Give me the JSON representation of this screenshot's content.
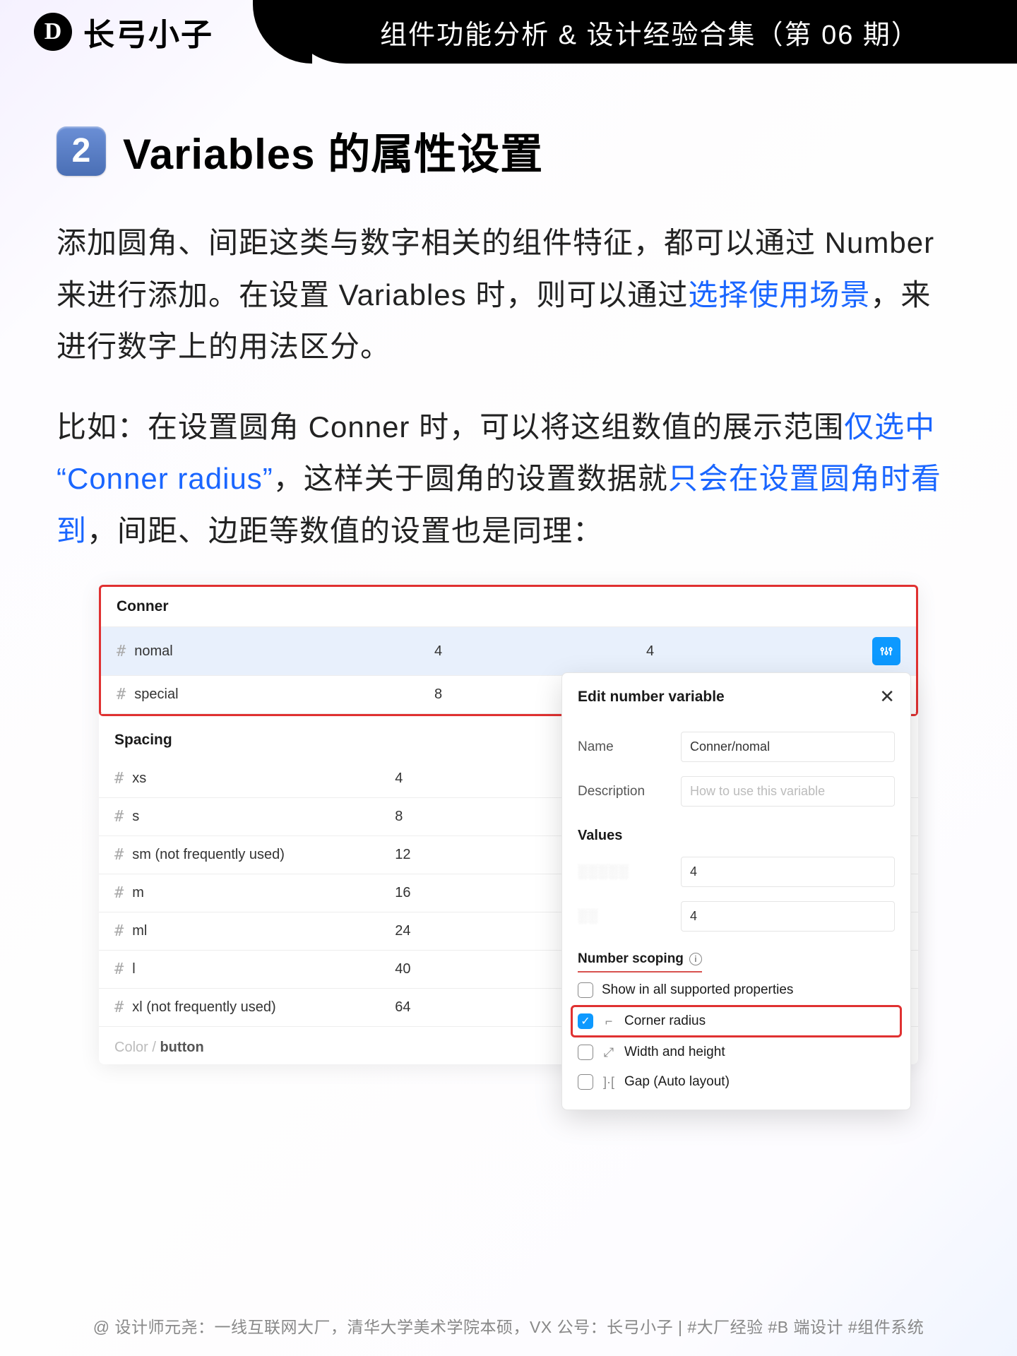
{
  "header": {
    "brand_logo_letter": "D",
    "brand_name": "长弓小子",
    "ribbon": "组件功能分析 & 设计经验合集（第 06 期）"
  },
  "section": {
    "number": "2",
    "title": "Variables 的属性设置"
  },
  "para1": {
    "t1": "添加圆角、间距这类与数字相关的组件特征，都可以通过 Number 来进行添加。在设置 Variables 时，则可以通过",
    "h1": "选择使用场景",
    "t2": "，来进行数字上的用法区分。"
  },
  "para2": {
    "t1": "比如：在设置圆角 Conner 时，可以将这组数值的展示范围",
    "h1": "仅选中 “Conner radius”",
    "t2": "，这样关于圆角的设置数据就",
    "h2": "只会在设置圆角时看到",
    "t3": "，间距、边距等数值的设置也是同理："
  },
  "panel": {
    "group1_title": "Conner",
    "row1": {
      "name": "nomal",
      "v1": "4",
      "v2": "4"
    },
    "row2": {
      "name": "special",
      "v1": "8"
    },
    "group2_title": "Spacing",
    "spacing": [
      {
        "name": "xs",
        "val": "4"
      },
      {
        "name": "s",
        "val": "8"
      },
      {
        "name": "sm (not frequently used)",
        "val": "12"
      },
      {
        "name": "m",
        "val": "16"
      },
      {
        "name": "ml",
        "val": "24"
      },
      {
        "name": "l",
        "val": "40"
      },
      {
        "name": "xl (not frequently used)",
        "val": "64"
      }
    ],
    "footer_grey": "Color / ",
    "footer_bold": "button"
  },
  "popover": {
    "title": "Edit number variable",
    "name_label": "Name",
    "name_value": "Conner/nomal",
    "desc_label": "Description",
    "desc_placeholder": "How to use this variable",
    "values_title": "Values",
    "val1_label": "░░░░░",
    "val1": "4",
    "val2_label": "░░",
    "val2": "4",
    "scoping_title": "Number scoping",
    "opt_all": "Show in all supported properties",
    "opt_corner": "Corner radius",
    "opt_wh": "Width and height",
    "opt_gap": "Gap (Auto layout)"
  },
  "footer": "@ 设计师元尧：一线互联网大厂，清华大学美术学院本硕，VX 公号：长弓小子  |  #大厂经验  #B 端设计  #组件系统"
}
